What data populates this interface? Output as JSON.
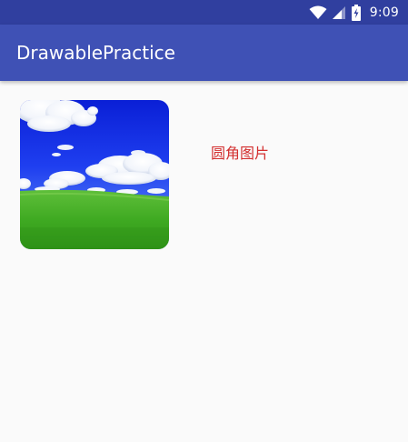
{
  "status_bar": {
    "time": "9:09",
    "icons": [
      "wifi-icon",
      "cell-signal-icon",
      "battery-charging-icon"
    ],
    "color": "#303f9f"
  },
  "app_bar": {
    "title": "DrawablePractice",
    "color": "#3f51b5"
  },
  "content": {
    "image": {
      "type": "rounded-corner-image",
      "subject": "blue sky with white clouds above green grass field"
    },
    "caption": "圆角图片",
    "caption_color": "#d32f2f"
  }
}
